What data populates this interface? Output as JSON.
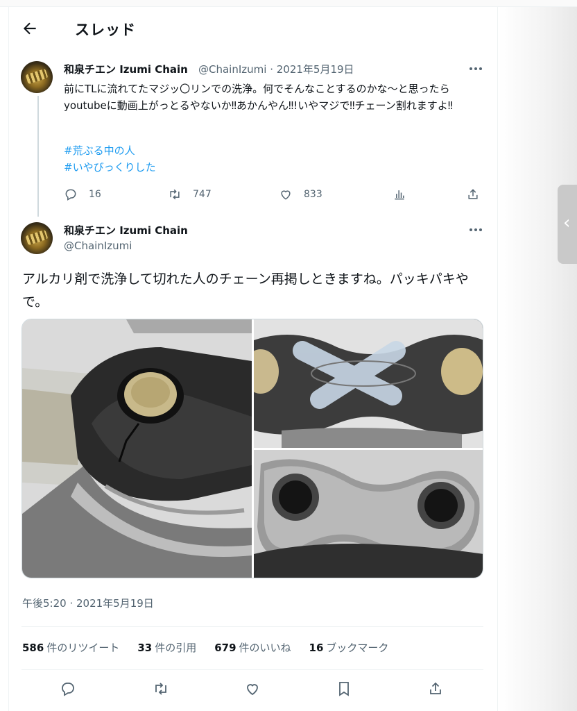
{
  "header": {
    "title": "スレッド"
  },
  "tweet1": {
    "name": "和泉チエン Izumi Chain",
    "handle": "@ChainIzumi",
    "date": "· 2021年5月19日",
    "text": "前にTLに流れてたマジッ〇リンでの洗浄。何でそんなことするのかな〜と思ったらyoutubeに動画上がっとるやないか‼︎あかんやん‼︎!いやマジで‼︎チェーン割れますよ‼︎",
    "hashtags": [
      "#荒ぶる中の人",
      "#いやびっくりした"
    ],
    "actions": {
      "replies": "16",
      "retweets": "747",
      "likes": "833"
    }
  },
  "tweet2": {
    "name": "和泉チエン Izumi Chain",
    "handle": "@ChainIzumi",
    "text": "アルカリ剤で洗浄して切れた人のチェーン再掲しときますね。パッキパキやで。",
    "timestamp": "午後5:20 · 2021年5月19日",
    "stats": [
      {
        "count": "586",
        "label": "件のリツイート"
      },
      {
        "count": "33",
        "label": "件の引用"
      },
      {
        "count": "679",
        "label": "件のいいね"
      },
      {
        "count": "16",
        "label": "ブックマーク"
      }
    ]
  },
  "icons": [
    "back-arrow-icon",
    "more-icon",
    "reply-icon",
    "retweet-icon",
    "like-icon",
    "analytics-icon",
    "share-icon",
    "bookmark-icon",
    "chevron-left-icon"
  ],
  "colors": {
    "link": "#1d9bf0",
    "muted": "#536471",
    "text": "#0f1419"
  }
}
